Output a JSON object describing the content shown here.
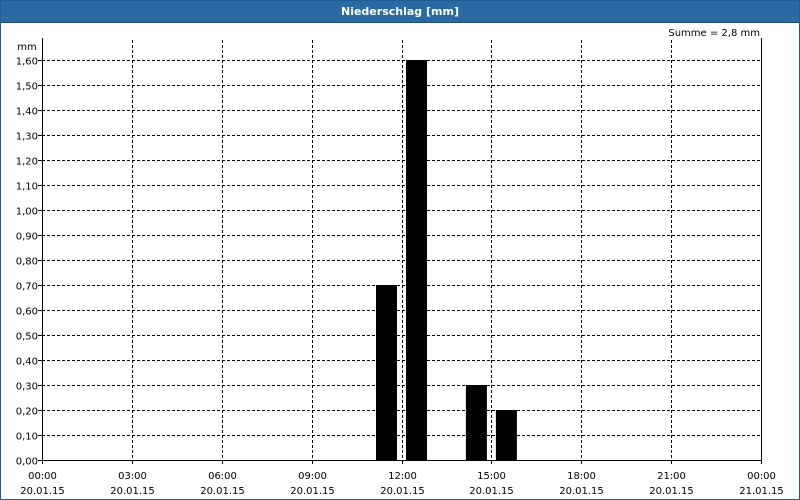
{
  "window": {
    "title": "Niederschlag [mm]"
  },
  "summary": "Summe = 2,8 mm",
  "chart_data": {
    "type": "bar",
    "title": "Niederschlag [mm]",
    "ylabel": "mm",
    "xlabel": "",
    "ylim": [
      0,
      1.6
    ],
    "xlim": [
      "2015-01-20T00:00",
      "2015-01-21T00:00"
    ],
    "yticks": [
      "0,00",
      "0,10",
      "0,20",
      "0,30",
      "0,40",
      "0,50",
      "0,60",
      "0,70",
      "0,80",
      "0,90",
      "1,00",
      "1,10",
      "1,20",
      "1,30",
      "1,40",
      "1,50",
      "1,60"
    ],
    "xticks": [
      {
        "time": "00:00",
        "date": "20.01.15"
      },
      {
        "time": "03:00",
        "date": "20.01.15"
      },
      {
        "time": "06:00",
        "date": "20.01.15"
      },
      {
        "time": "09:00",
        "date": "20.01.15"
      },
      {
        "time": "12:00",
        "date": "20.01.15"
      },
      {
        "time": "15:00",
        "date": "20.01.15"
      },
      {
        "time": "18:00",
        "date": "20.01.15"
      },
      {
        "time": "21:00",
        "date": "20.01.15"
      },
      {
        "time": "00:00",
        "date": "21.01.15"
      }
    ],
    "grid": true,
    "bar_color": "#000000",
    "bars": [
      {
        "start": "2015-01-20T11:00",
        "end": "2015-01-20T12:00",
        "value": 0.7
      },
      {
        "start": "2015-01-20T12:00",
        "end": "2015-01-20T13:00",
        "value": 1.6
      },
      {
        "start": "2015-01-20T14:00",
        "end": "2015-01-20T15:00",
        "value": 0.3
      },
      {
        "start": "2015-01-20T15:00",
        "end": "2015-01-20T16:00",
        "value": 0.2
      }
    ]
  }
}
